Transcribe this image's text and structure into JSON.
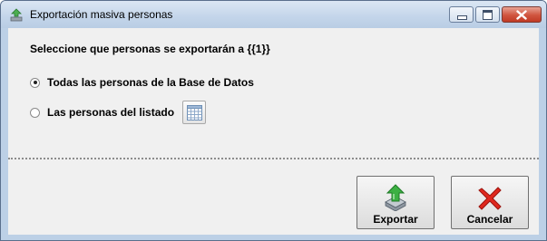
{
  "window": {
    "title": "Exportación masiva personas",
    "icon": "export-app-icon"
  },
  "main": {
    "heading": "Seleccione que personas se exportarán a {{1}}",
    "options": [
      {
        "label": "Todas las personas de la Base de Datos",
        "selected": true
      },
      {
        "label": "Las personas del listado",
        "selected": false
      }
    ],
    "list_button_icon": "grid-icon"
  },
  "actions": {
    "export_label": "Exportar",
    "cancel_label": "Cancelar"
  },
  "colors": {
    "export_arrow": "#3cb043",
    "cancel_x": "#e0281e",
    "close_button": "#c94b35"
  }
}
